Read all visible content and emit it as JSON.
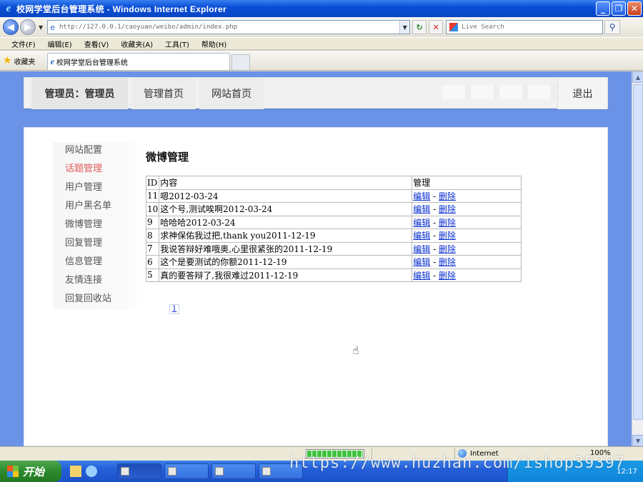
{
  "window": {
    "title": "校网学堂后台管理系统 - Windows Internet Explorer",
    "buttons": [
      "_",
      "❐",
      "✕"
    ]
  },
  "address": {
    "url": "http://127.0.0.1/caoyuan/weibo/admin/index.php",
    "search_placeholder": "Live Search"
  },
  "menu": [
    "文件(F)",
    "编辑(E)",
    "查看(V)",
    "收藏夹(A)",
    "工具(T)",
    "帮助(H)"
  ],
  "favorites": {
    "label": "收藏夹",
    "tab_title": "校网学堂后台管理系统"
  },
  "topnav": {
    "admin": "管理员：管理员",
    "home": "管理首页",
    "site": "网站首页",
    "logout": "退出"
  },
  "sidebar": {
    "items": [
      {
        "label": "网站配置"
      },
      {
        "label": "话题管理"
      },
      {
        "label": "用户管理"
      },
      {
        "label": "用户黑名单"
      },
      {
        "label": "微博管理"
      },
      {
        "label": "回复管理"
      },
      {
        "label": "信息管理"
      },
      {
        "label": "友情连接"
      },
      {
        "label": "回复回收站"
      }
    ]
  },
  "content": {
    "title": "微博管理",
    "headers": {
      "id": "ID",
      "content": "内容",
      "manage": "管理"
    },
    "edit_label": "编辑",
    "sep": " - ",
    "delete_label": "删除",
    "rows": [
      {
        "id": "11",
        "text": "嗯2012-03-24"
      },
      {
        "id": "10",
        "text": "这个号,测试唉啊2012-03-24"
      },
      {
        "id": "9",
        "text": "哈哈哈2012-03-24"
      },
      {
        "id": "8",
        "text": "求神保佑我过把,thank you2011-12-19"
      },
      {
        "id": "7",
        "text": "我说答辩好难哦奥,心里很紧张的2011-12-19"
      },
      {
        "id": "6",
        "text": "这个是要测试的你额2011-12-19"
      },
      {
        "id": "5",
        "text": "真的要答辩了,我很难过2011-12-19"
      }
    ],
    "pager": "1"
  },
  "status": {
    "zone": "Internet",
    "zoom": "100%",
    "progress": 1.0
  },
  "taskbar": {
    "start": "开始",
    "clock": "12:17"
  },
  "watermark": "https://www.huzhan.com/ishop39397"
}
